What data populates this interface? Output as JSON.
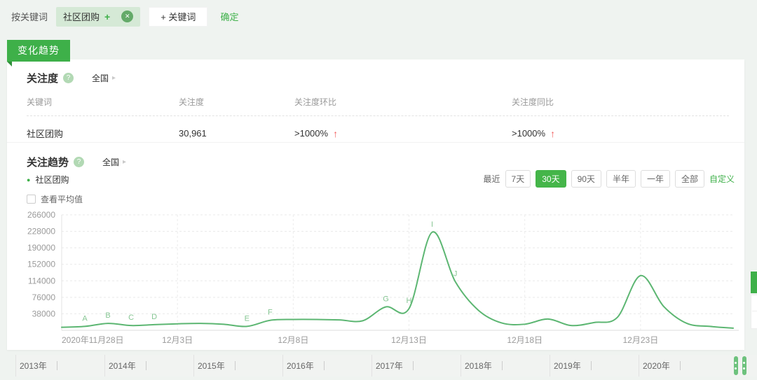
{
  "filter_bar": {
    "label": "按关键词",
    "keyword_tag": {
      "text": "社区团购"
    },
    "add_keyword": "+ 关键词",
    "confirm": "确定"
  },
  "ribbon": "变化趋势",
  "icons": {
    "help": "?",
    "chevron_right": "▸",
    "close": "✕",
    "plus": "+",
    "up_arrow": "↑",
    "legend_dot": "●"
  },
  "attention": {
    "title": "关注度",
    "region": "全国",
    "table": {
      "headers": [
        "关键词",
        "关注度",
        "关注度环比",
        "关注度同比"
      ],
      "rows": [
        {
          "keyword": "社区团购",
          "value": "30,961",
          "mom": ">1000%",
          "yoy": ">1000%"
        }
      ]
    }
  },
  "trend": {
    "title": "关注趋势",
    "region": "全国",
    "legend": "社区团购",
    "average_label": "查看平均值",
    "recent_label": "最近",
    "ranges": [
      "7天",
      "30天",
      "90天",
      "半年",
      "一年",
      "全部"
    ],
    "selected_range": "30天",
    "custom_label": "自定义"
  },
  "chart_data": {
    "type": "line",
    "title": "关注趋势 - 社区团购",
    "series": [
      {
        "name": "社区团购",
        "color": "#5cb672",
        "values": [
          7000,
          9000,
          16000,
          11000,
          13000,
          15000,
          16000,
          14000,
          9000,
          23000,
          25000,
          25000,
          24000,
          22000,
          54000,
          50000,
          226000,
          112000,
          46000,
          17000,
          14000,
          26000,
          11000,
          18000,
          30000,
          126000,
          55000,
          16000,
          9000,
          5000
        ]
      }
    ],
    "x_tick_labels": [
      {
        "index": 0,
        "label": "2020年11月28日"
      },
      {
        "index": 5,
        "label": "12月3日"
      },
      {
        "index": 10,
        "label": "12月8日"
      },
      {
        "index": 15,
        "label": "12月13日"
      },
      {
        "index": 20,
        "label": "12月18日"
      },
      {
        "index": 25,
        "label": "12月23日"
      }
    ],
    "y_ticks": [
      38000,
      76000,
      114000,
      152000,
      190000,
      228000,
      266000
    ],
    "ylim": [
      0,
      266000
    ],
    "point_labels": [
      {
        "index": 1,
        "label": "A"
      },
      {
        "index": 2,
        "label": "B"
      },
      {
        "index": 3,
        "label": "C"
      },
      {
        "index": 4,
        "label": "D"
      },
      {
        "index": 8,
        "label": "E"
      },
      {
        "index": 9,
        "label": "F"
      },
      {
        "index": 14,
        "label": "G"
      },
      {
        "index": 15,
        "label": "H"
      },
      {
        "index": 16,
        "label": "I"
      },
      {
        "index": 17,
        "label": "J"
      }
    ],
    "grid": "dashed",
    "legend_position": "top-left"
  },
  "timeline": {
    "years": [
      "2013年",
      "2014年",
      "2015年",
      "2016年",
      "2017年",
      "2018年",
      "2019年",
      "2020年"
    ]
  },
  "colors": {
    "accent": "#3eb049",
    "accent_light": "#d5e9d6",
    "line": "#5cb672",
    "up_red": "#f25b5b",
    "page_bg": "#eff3f0",
    "point_label": "#86c693"
  }
}
